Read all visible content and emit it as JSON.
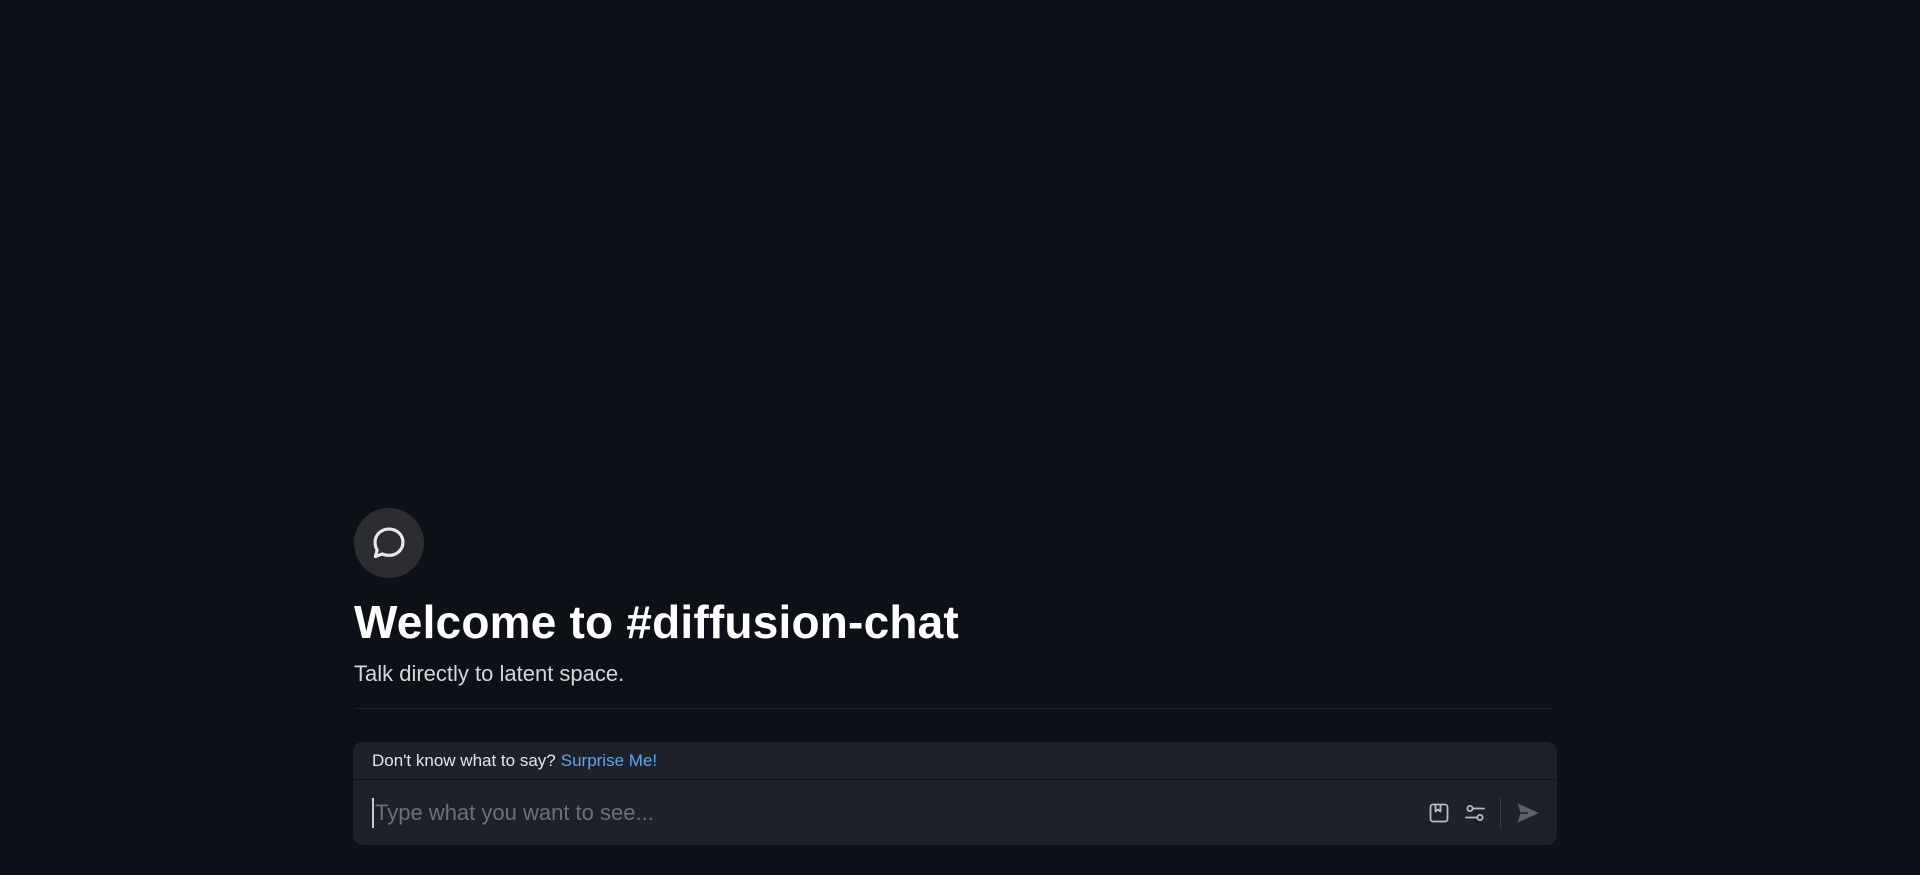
{
  "welcome": {
    "icon": "chat-bubble-icon",
    "title": "Welcome to #diffusion-chat",
    "subtitle": "Talk directly to latent space."
  },
  "composer": {
    "suggestion_prompt": "Don't know what to say?",
    "suggestion_link": "Surprise Me!",
    "input_placeholder": "Type what you want to see...",
    "input_value": "",
    "icons": [
      "bookmark-icon",
      "sliders-icon",
      "send-icon"
    ]
  },
  "colors": {
    "background": "#0d1017",
    "composer_bg": "#1e212a",
    "link": "#5aa7f5",
    "icon_circle": "#2b2d33"
  }
}
